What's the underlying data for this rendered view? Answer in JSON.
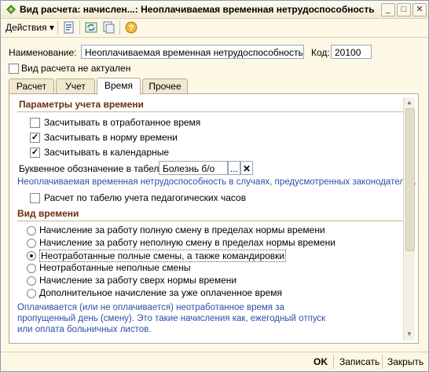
{
  "window": {
    "title": "Вид расчета: начислен...: Неоплачиваемая временная нетрудоспособность",
    "minimize": "_",
    "maximize": "□",
    "close": "✕"
  },
  "toolbar": {
    "actions_label": "Действия ▾"
  },
  "form": {
    "name_label": "Наименование:",
    "name_value": "Неоплачиваемая временная нетрудоспособность",
    "code_label": "Код:",
    "code_value": "20100",
    "not_actual_label": "Вид расчета не актуален"
  },
  "tabs": [
    {
      "label": "Расчет"
    },
    {
      "label": "Учет"
    },
    {
      "label": "Время"
    },
    {
      "label": "Прочее"
    }
  ],
  "time_params": {
    "section_title": "Параметры учета времени",
    "cb1_label": "Засчитывать в отработанное время",
    "cb2_label": "Засчитывать в норму времени",
    "cb3_label": "Засчитывать в календарные",
    "letter_label": "Буквенное обозначение в табеле:",
    "letter_value": "Болезнь б/о",
    "ellipsis": "...",
    "clear": "✕",
    "hint": "Неоплачиваемая временная нетрудоспособность в случаях, предусмотренных законодатель...",
    "cb4_label": "Расчет по табелю учета педагогических часов",
    "check": "✓"
  },
  "time_kind": {
    "section_title": "Вид времени",
    "options": [
      "Начисление за работу полную смену в пределах нормы времени",
      "Начисление за работу неполную смену в пределах нормы времени",
      "Неотработанные полные смены, а также командировки",
      "Неотработанные неполные смены",
      "Начисление за работу сверх нормы времени",
      "Дополнительное начисление за уже оплаченное время"
    ],
    "description": "Оплачивается (или не оплачивается) неотработанное время за пропущенный день (смену). Это такие начисления как, ежегодный отпуск или оплата больничных листов."
  },
  "footer": {
    "ok": "OK",
    "save": "Записать",
    "close": "Закрыть"
  },
  "colors": {
    "accent": "#6b2f0c",
    "hint": "#2d4fa8",
    "bg": "#fdf7e6"
  }
}
